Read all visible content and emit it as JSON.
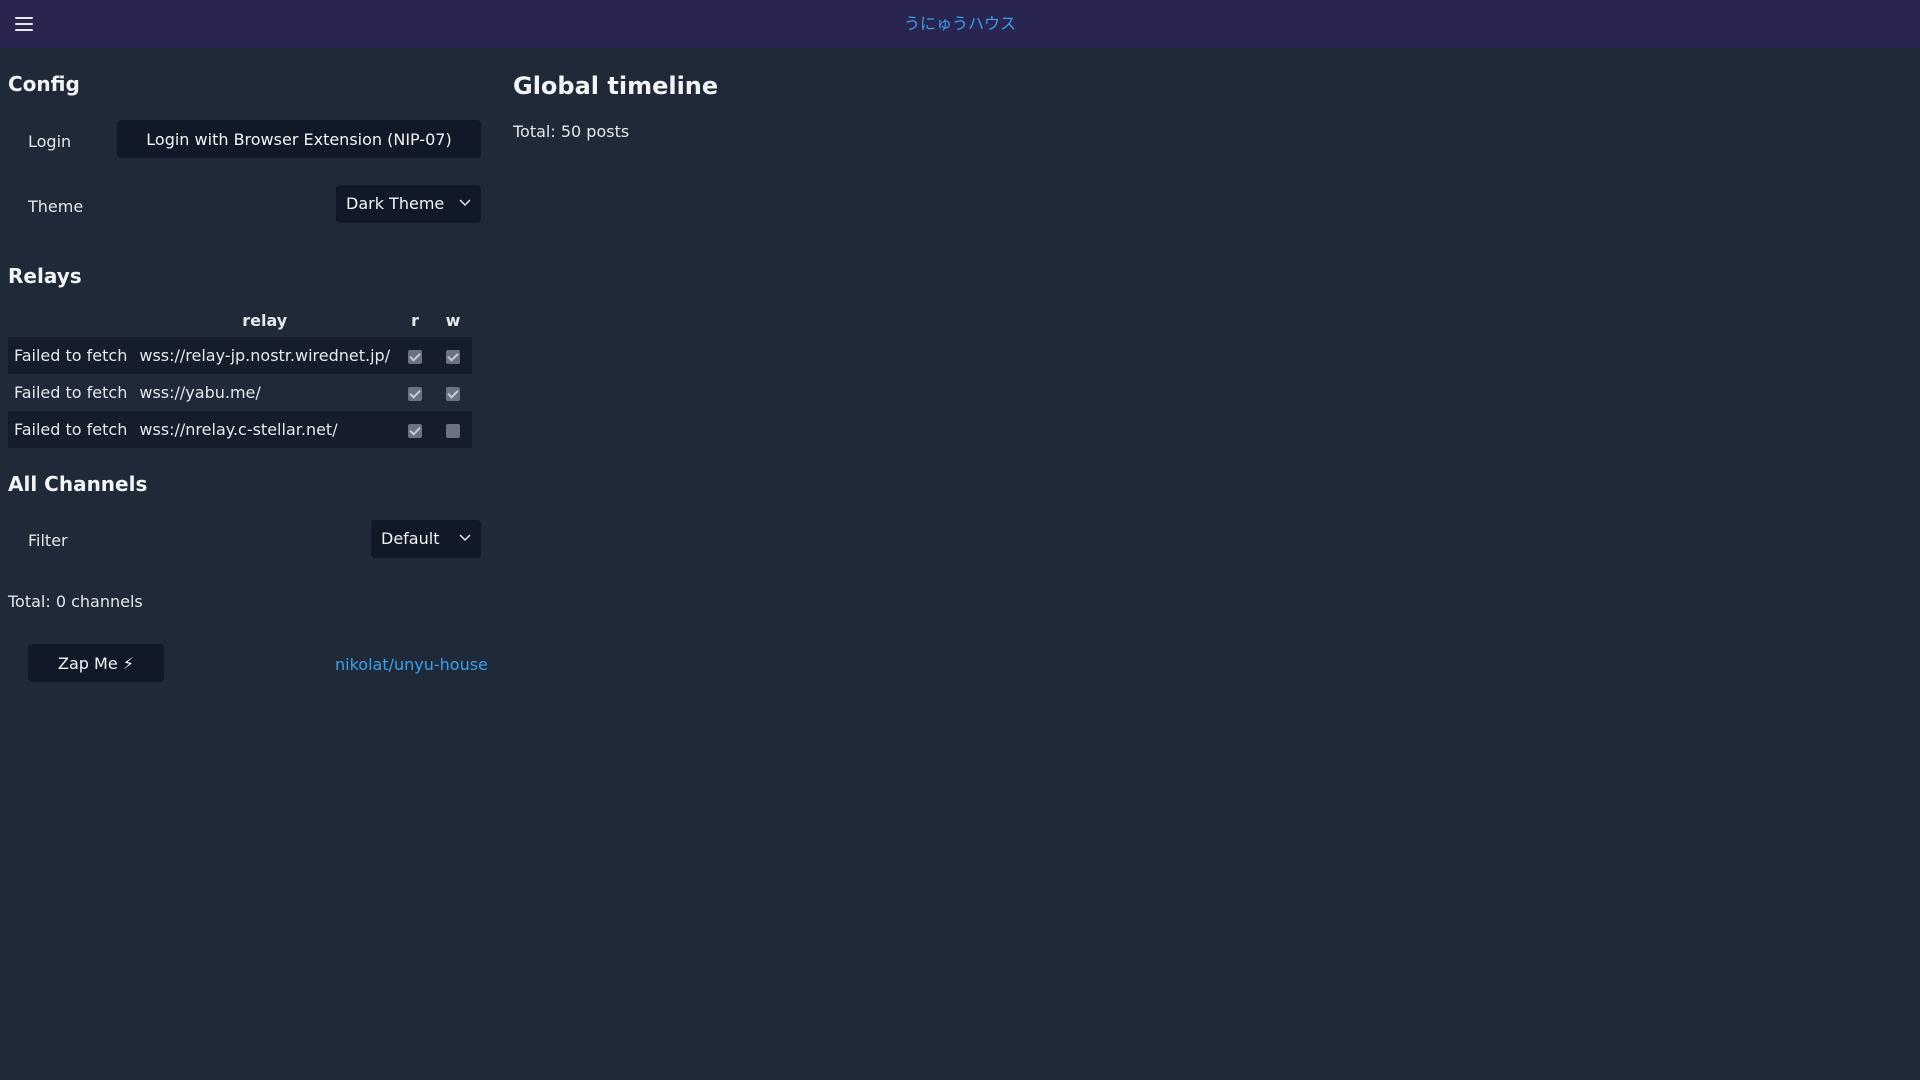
{
  "header": {
    "title": "うにゅうハウス",
    "menu_icon": "hamburger-menu-icon"
  },
  "config": {
    "title": "Config",
    "login_label": "Login",
    "login_button": "Login with Browser Extension (NIP-07)",
    "theme_label": "Theme",
    "theme_value": "Dark Theme"
  },
  "relays": {
    "title": "Relays",
    "columns": [
      "",
      "relay",
      "r",
      "w"
    ],
    "rows": [
      {
        "status": "Failed to fetch",
        "url": "wss://relay-jp.nostr.wirednet.jp/",
        "read": true,
        "write": true
      },
      {
        "status": "Failed to fetch",
        "url": "wss://yabu.me/",
        "read": true,
        "write": true
      },
      {
        "status": "Failed to fetch",
        "url": "wss://nrelay.c-stellar.net/",
        "read": true,
        "write": false
      }
    ]
  },
  "channels": {
    "title": "All Channels",
    "filter_label": "Filter",
    "filter_value": "Default",
    "total": "Total: 0 channels"
  },
  "footer": {
    "zap_button": "Zap Me ⚡",
    "repo_link": "nikolat/unyu-house"
  },
  "main": {
    "title": "Global timeline",
    "total": "Total: 50 posts"
  },
  "colors": {
    "background": "#1f2937",
    "header": "#2a2550",
    "accent": "#3b9fec"
  }
}
